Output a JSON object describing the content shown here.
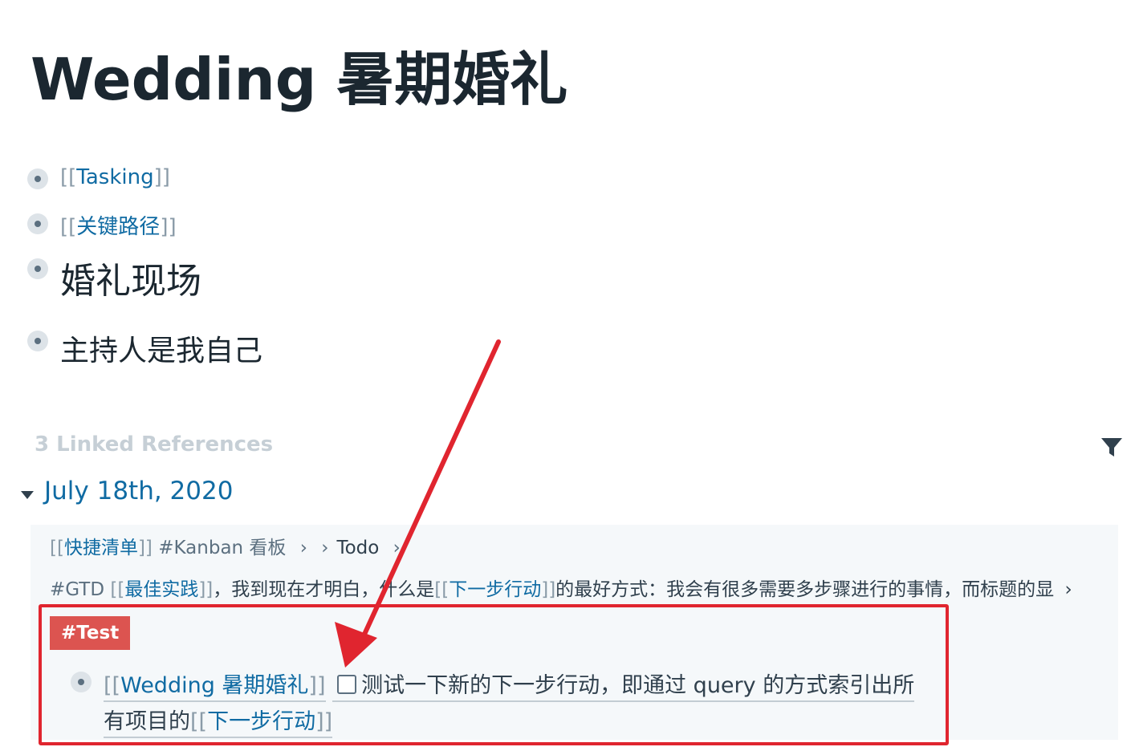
{
  "page": {
    "title": "Wedding 暑期婚礼"
  },
  "blocks": [
    {
      "open": "[[",
      "link": "Tasking",
      "close": "]]"
    },
    {
      "open": "[[",
      "link": "关键路径",
      "close": "]]"
    },
    {
      "text": "婚礼现场"
    },
    {
      "text": "主持人是我自己"
    }
  ],
  "references": {
    "title": "3 Linked References",
    "filter_icon": "filter-icon",
    "group": {
      "date": "July 18th, 2020",
      "breadcrumb": {
        "open": "[[",
        "link": "快捷清单",
        "close": "]]",
        "tag": "#Kanban 看板",
        "sep1": "›",
        "sep2": "›",
        "item": "Todo",
        "sep3": "›"
      },
      "context": {
        "tag": "#GTD",
        "open1": "[[",
        "link1": "最佳实践",
        "close1": "]]",
        "text1": "，我到现在才明白，什么是",
        "open2": "[[",
        "link2": "下一步行动",
        "close2": "]]",
        "text2": "的最好方式：我会有很多需要多步骤进行的事情，而标题的显",
        "chevron": "›"
      },
      "tag_badge": "#Test",
      "todo": {
        "open1": "[[",
        "link1": "Wedding 暑期婚礼",
        "close1": "]]",
        "text_line1": "测试一下新的下一步行动，即通过 query 的方式索引出所",
        "text_line2": "有项目的",
        "open2": "[[",
        "link2": "下一步行动",
        "close2": "]]",
        "checked": false
      }
    }
  },
  "annotation": {
    "color": "#e0252f"
  }
}
